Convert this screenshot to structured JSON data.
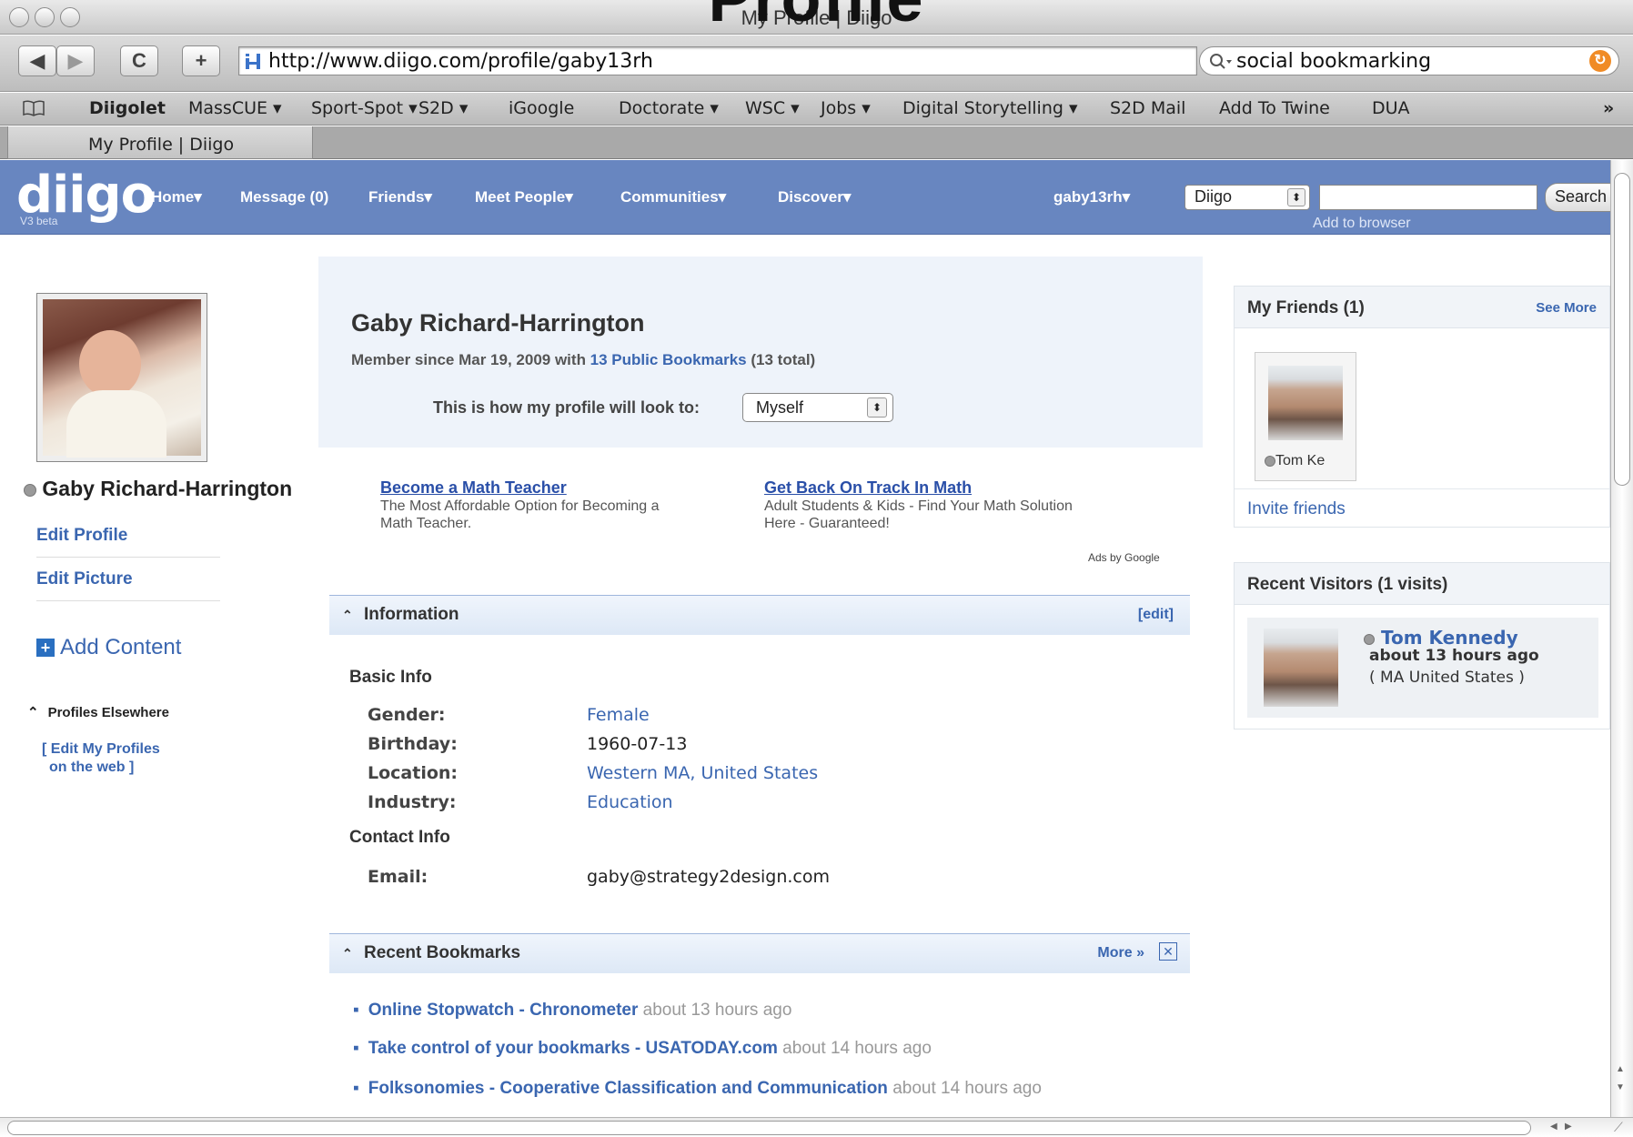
{
  "overlay_title": "Profile",
  "window": {
    "title": "My Profile | Diigo"
  },
  "toolbar": {
    "back": "◀",
    "forward": "▶",
    "reload": "C",
    "add": "+",
    "url": "http://www.diigo.com/profile/gaby13rh",
    "search_value": "social bookmarking"
  },
  "bookmarks_bar": [
    "Diigolet",
    "MassCUE ▾",
    "Sport-Spot ▾",
    "S2D ▾",
    "iGoogle",
    "Doctorate ▾",
    "WSC ▾",
    "Jobs ▾",
    "Digital Storytelling ▾",
    "S2D Mail",
    "Add To Twine",
    "DUA"
  ],
  "bookmarks_overflow": "»",
  "tab": {
    "label": "My Profile | Diigo"
  },
  "diigo_header": {
    "logo": "diigo",
    "beta": "V3 beta",
    "nav": [
      "Home▾",
      "Message (0)",
      "Friends▾",
      "Meet People▾",
      "Communities▾",
      "Discover▾"
    ],
    "user": "gaby13rh▾",
    "search_scope": "Diigo",
    "search_button": "Search",
    "add_to_browser": "Add to browser"
  },
  "left": {
    "name": "Gaby Richard-Harrington",
    "edit_profile": "Edit Profile",
    "edit_picture": "Edit Picture",
    "add_content": "Add Content",
    "profiles_elsewhere": "Profiles Elsewhere",
    "edit_profiles_line1": "[ Edit My Profiles",
    "edit_profiles_line2": "on the web ]"
  },
  "profile": {
    "name": "Gaby Richard-Harrington",
    "member_prefix": "Member since Mar 19, 2009 with ",
    "member_link": "13 Public Bookmarks",
    "member_suffix": " (13 total)",
    "view_label": "This is how my profile will look to:",
    "view_value": "Myself"
  },
  "ads": [
    {
      "title": "Become a Math Teacher",
      "line1": "The Most Affordable Option for Becoming a",
      "line2": "Math Teacher."
    },
    {
      "title": "Get Back On Track In Math",
      "line1": "Adult Students & Kids - Find Your Math Solution",
      "line2": "Here - Guaranteed!"
    }
  ],
  "ads_by": "Ads by Google",
  "information": {
    "title": "Information",
    "edit": "[edit]",
    "basic_info": "Basic Info",
    "gender_label": "Gender:",
    "gender": "Female",
    "birthday_label": "Birthday:",
    "birthday": "1960-07-13",
    "location_label": "Location:",
    "location_city": "Western MA",
    "location_sep": ", ",
    "location_country": "United States",
    "industry_label": "Industry:",
    "industry": "Education",
    "contact_info": "Contact Info",
    "email_label": "Email:",
    "email": "gaby@strategy2design.com"
  },
  "recent_bookmarks": {
    "title": "Recent Bookmarks",
    "more": "More »",
    "items": [
      {
        "title": "Online Stopwatch - Chronometer",
        "time": "about 13 hours ago"
      },
      {
        "title": "Take control of your bookmarks - USATODAY.com",
        "time": "about 14 hours ago"
      },
      {
        "title": "Folksonomies - Cooperative Classification and Communication",
        "time": "about 14 hours ago"
      }
    ]
  },
  "friends": {
    "title": "My Friends (1)",
    "see_more": "See More",
    "friend_name": "Tom Ke",
    "invite": "Invite friends"
  },
  "visitors": {
    "title": "Recent Visitors (1 visits)",
    "name": "Tom Kennedy",
    "time": "about 13 hours ago",
    "location": "( MA United States )"
  }
}
